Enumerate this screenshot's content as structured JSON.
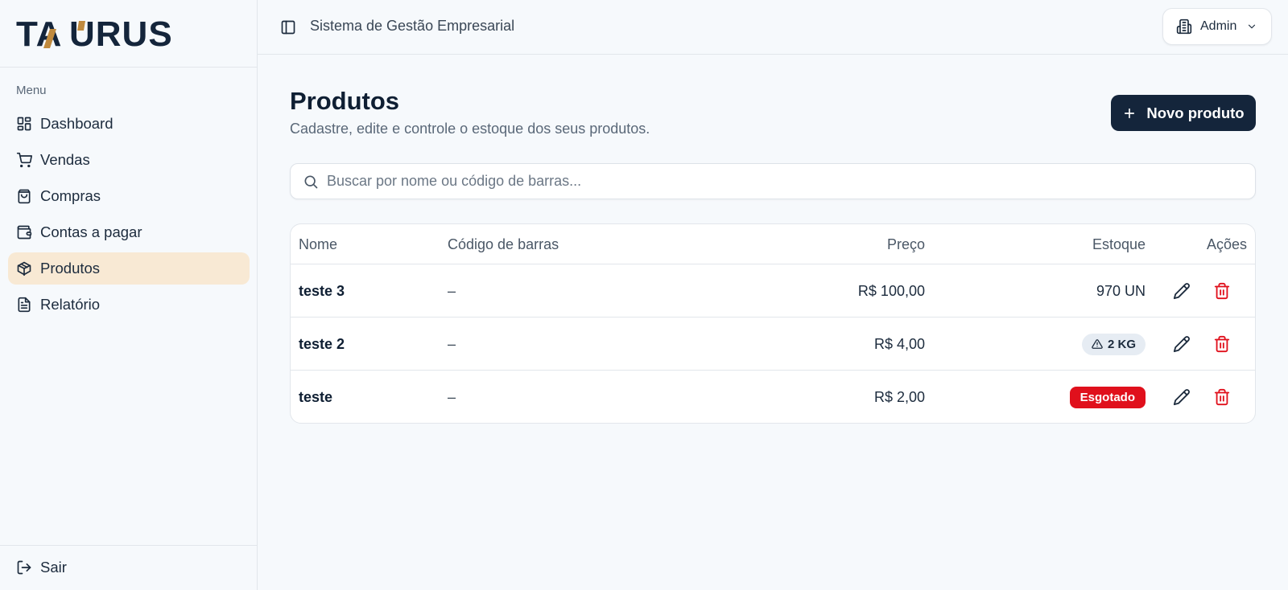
{
  "brand": {
    "logo_text": "TAURUS"
  },
  "sidebar": {
    "menu_heading": "Menu",
    "items": [
      {
        "label": "Dashboard",
        "icon": "dashboard-icon",
        "active": false
      },
      {
        "label": "Vendas",
        "icon": "cart-icon",
        "active": false
      },
      {
        "label": "Compras",
        "icon": "shopping-bag-icon",
        "active": false
      },
      {
        "label": "Contas a pagar",
        "icon": "wallet-icon",
        "active": false
      },
      {
        "label": "Produtos",
        "icon": "package-icon",
        "active": true
      },
      {
        "label": "Relatório",
        "icon": "file-text-icon",
        "active": false
      }
    ],
    "logout_label": "Sair"
  },
  "header": {
    "system_title": "Sistema de Gestão Empresarial",
    "user_label": "Admin"
  },
  "main": {
    "title": "Produtos",
    "subtitle": "Cadastre, edite e controle o estoque dos seus produtos.",
    "new_button_label": "Novo produto",
    "search_placeholder": "Buscar por nome ou código de barras...",
    "table": {
      "columns": [
        "Nome",
        "Código de barras",
        "Preço",
        "Estoque",
        "Ações"
      ],
      "rows": [
        {
          "name": "teste 3",
          "barcode": "–",
          "price": "R$ 100,00",
          "stock": "970 UN",
          "stock_status": "ok"
        },
        {
          "name": "teste 2",
          "barcode": "–",
          "price": "R$ 4,00",
          "stock": "2 KG",
          "stock_status": "low"
        },
        {
          "name": "teste",
          "barcode": "–",
          "price": "R$ 2,00",
          "stock": "Esgotado",
          "stock_status": "out"
        }
      ]
    }
  },
  "colors": {
    "navy": "#14253b",
    "accent_gold": "#c08a3e",
    "active_bg": "#f8e9d4",
    "danger": "#e0101c"
  }
}
